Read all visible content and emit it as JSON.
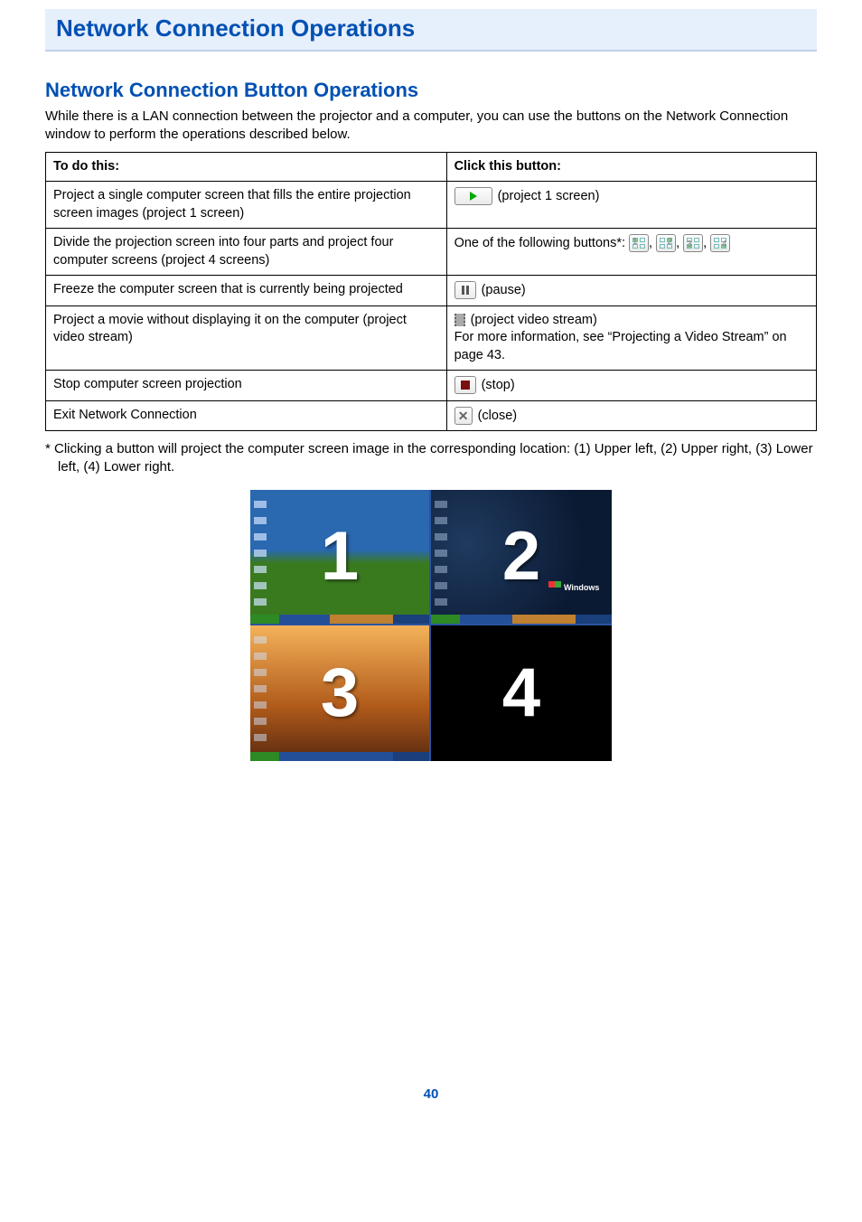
{
  "title": "Network Connection Operations",
  "subheading": "Network Connection Button Operations",
  "intro": "While there is a LAN connection between the projector and a computer, you can use the buttons on the Network Connection window to perform the operations described below.",
  "table": {
    "header_left": "To do this:",
    "header_right": "Click this button:",
    "rows": [
      {
        "action": "Project a single computer screen that fills the entire projection screen images (project 1 screen)",
        "button_label": "(project 1 screen)"
      },
      {
        "action": "Divide the projection screen into four parts and project four computer screens (project 4 screens)",
        "prefix": "One of the following buttons*:",
        "sep": ",",
        "q_labels": [
          "1",
          "2",
          "3",
          "4"
        ]
      },
      {
        "action": "Freeze the computer screen that is currently being projected",
        "button_label": "(pause)"
      },
      {
        "action": "Project a movie without displaying it on the computer (project video stream)",
        "button_label": "(project video stream)",
        "extra": "For more information, see “Projecting a Video Stream” on page 43."
      },
      {
        "action": "Stop computer screen projection",
        "button_label": "(stop)"
      },
      {
        "action": "Exit Network Connection",
        "button_label": "(close)"
      }
    ]
  },
  "footnote": "* Clicking a button will project the computer screen image in the corresponding location: (1) Upper left, (2) Upper right, (3) Lower left, (4) Lower right.",
  "diagram": {
    "labels": [
      "1",
      "2",
      "3",
      "4"
    ],
    "brand": "Windows"
  },
  "page_number": "40"
}
